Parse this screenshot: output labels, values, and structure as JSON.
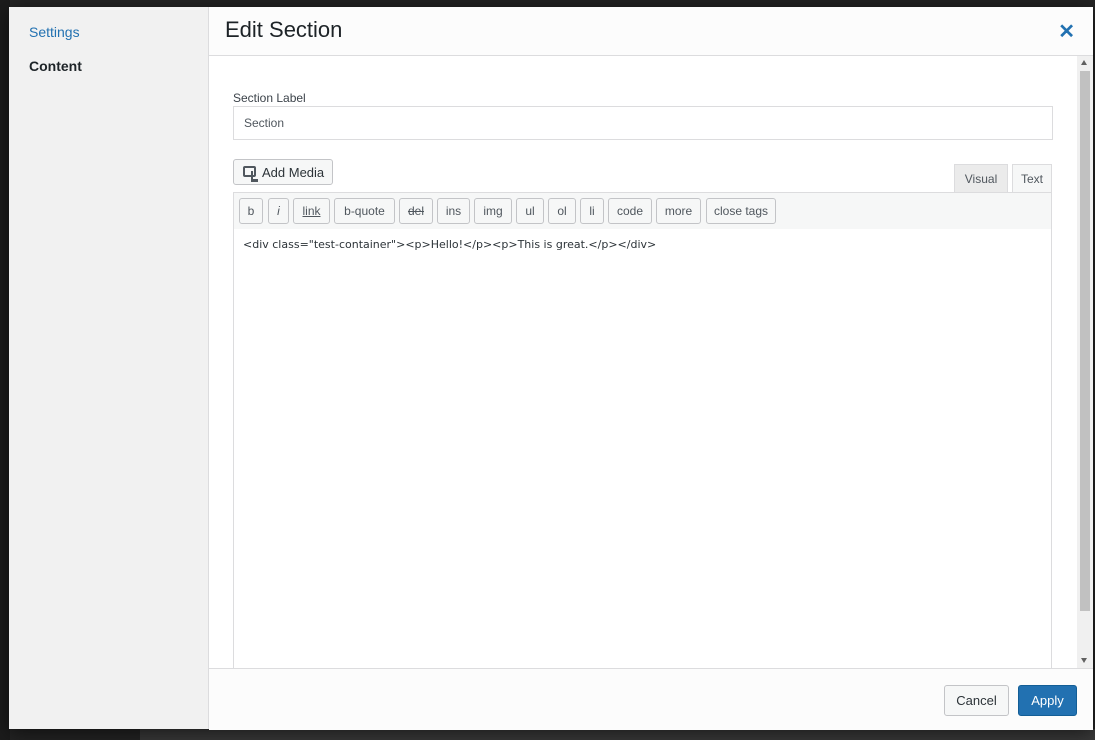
{
  "sidebar": {
    "items": [
      {
        "label": "Settings"
      },
      {
        "label": "Content"
      }
    ]
  },
  "header": {
    "title": "Edit Section",
    "close_glyph": "✕"
  },
  "form": {
    "section_label": {
      "label": "Section Label",
      "value": "Section"
    }
  },
  "editor": {
    "add_media_label": "Add Media",
    "tabs": [
      {
        "label": "Visual"
      },
      {
        "label": "Text"
      }
    ],
    "active_tab": "Text",
    "quicktags": [
      {
        "label": "b"
      },
      {
        "label": "i"
      },
      {
        "label": "link"
      },
      {
        "label": "b-quote"
      },
      {
        "label": "del"
      },
      {
        "label": "ins"
      },
      {
        "label": "img"
      },
      {
        "label": "ul"
      },
      {
        "label": "ol"
      },
      {
        "label": "li"
      },
      {
        "label": "code"
      },
      {
        "label": "more"
      },
      {
        "label": "close tags"
      }
    ],
    "content": "<div class=\"test-container\"><p>Hello!</p><p>This is great.</p></div>"
  },
  "footer": {
    "cancel_label": "Cancel",
    "apply_label": "Apply"
  },
  "colors": {
    "accent": "#2271b1",
    "apply_bg": "#2271b1"
  }
}
